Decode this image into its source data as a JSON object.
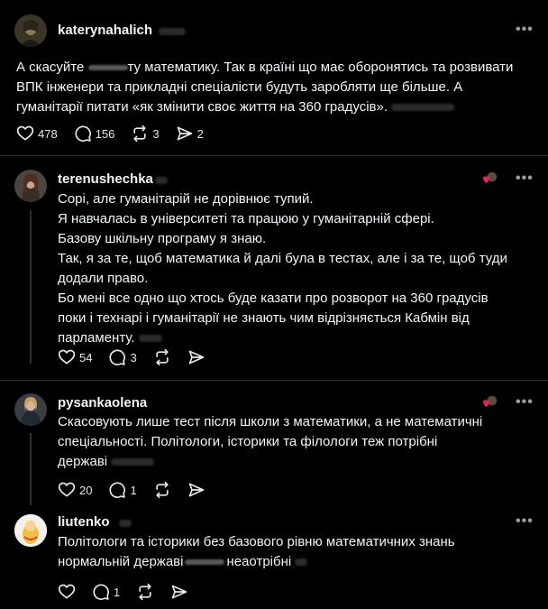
{
  "posts": [
    {
      "username": "katerynahalich",
      "text_lines": [
        "А скасуйте",
        "ту математику. Так в країні що має оборонятись та розвивати",
        "ВПК інженери та прикладні спеціалісти будуть заробляти ще більше. А",
        "гуманітарії питати «як змінити своє життя на 360 градусів»."
      ],
      "likes": "478",
      "replies": "156",
      "reposts": "3",
      "shares": "2"
    },
    {
      "username": "terenushechka",
      "text_lines": [
        "Сорі, але гуманітарій не дорівнює тупий.",
        "Я навчалась в університеті та працюю у гуманітарній сфері.",
        "Базову шкільну програму я знаю.",
        "Так, я за те, щоб математика й далі була в тестах, але і за те, щоб туди",
        "додали право.",
        "Бо мені все одно що хтось буде казати про розворот на 360 градусів",
        "поки і технарі і гуманітарії не знають чим відрізняється Кабмін від",
        "парламенту."
      ],
      "likes": "54",
      "replies": "3"
    },
    {
      "username": "pysankaolena",
      "text_lines": [
        "Скасовують лише тест після школи з математики, а не математичні",
        "спеціальності. Політологи, історики та філологи теж потрібні",
        "державі"
      ],
      "likes": "20",
      "replies": "1"
    },
    {
      "username": "liutenko",
      "text_lines": [
        "Політологи та історики без базового рівню математичних знань",
        "нормальній державі",
        "неаотрібні"
      ],
      "replies": "1"
    }
  ],
  "colors": {
    "background": "#000000",
    "text": "#f3f5f7",
    "muted": "#9a9a9a",
    "divider": "#2e2e2e",
    "heart_red": "#e0245e"
  },
  "icons": [
    "heart-icon",
    "comment-icon",
    "repost-icon",
    "share-icon",
    "more-icon"
  ]
}
